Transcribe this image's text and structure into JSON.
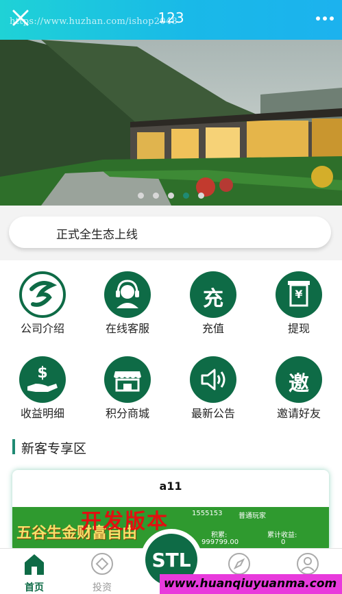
{
  "topbar": {
    "title": "123",
    "url_watermark": "https://www.huzhan.com/ishop2048"
  },
  "banner": {
    "slide_count": 5,
    "active_index": 3
  },
  "notice": {
    "text": "正式全生态上线"
  },
  "menu": [
    {
      "label": "公司介绍",
      "icon": "company-logo-icon"
    },
    {
      "label": "在线客服",
      "icon": "customer-service-icon"
    },
    {
      "label": "充值",
      "icon": "recharge-icon"
    },
    {
      "label": "提现",
      "icon": "withdraw-icon"
    },
    {
      "label": "收益明细",
      "icon": "income-hand-icon"
    },
    {
      "label": "积分商城",
      "icon": "shop-icon"
    },
    {
      "label": "最新公告",
      "icon": "speaker-icon"
    },
    {
      "label": "邀请好友",
      "icon": "invite-icon"
    }
  ],
  "menu_glyphs": {
    "recharge": "充",
    "invite": "邀",
    "dollar": "$",
    "yen": "¥"
  },
  "section": {
    "title": "新客专享区"
  },
  "product": {
    "name": "a11",
    "image_overlay": "开发版本",
    "slogan": "五谷生金财富自由",
    "phone": "1555153",
    "level": "普通玩家",
    "stat1_label": "积累:",
    "stat1_value": "999799.00",
    "stat2_label": "累计收益:",
    "stat2_value": "0"
  },
  "tabbar": {
    "home": "首页",
    "invest": "投资",
    "center_logo": "STL"
  },
  "watermark": {
    "text": "www.huanqiuyuanma.com"
  },
  "colors": {
    "brand_green": "#0e6b46",
    "accent_teal": "#1f8a73",
    "header_gradient_start": "#1fd2d6",
    "header_gradient_end": "#1cb2ee"
  }
}
